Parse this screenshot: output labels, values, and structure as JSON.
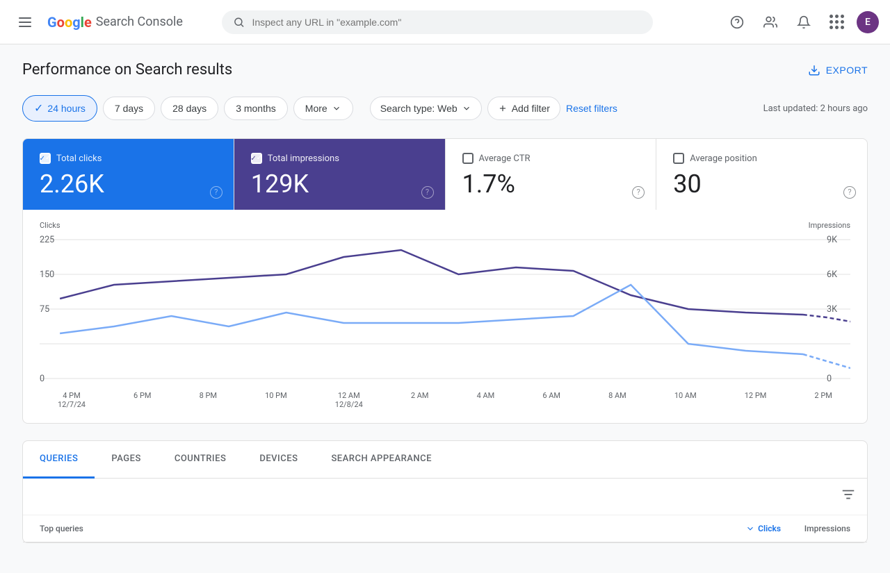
{
  "app": {
    "title": "Google Search Console",
    "logo_text": "Google",
    "logo_product": "Search Console"
  },
  "navbar": {
    "search_placeholder": "Inspect any URL in \"example.com\"",
    "avatar_initial": "E"
  },
  "page": {
    "title": "Performance on Search results",
    "export_label": "EXPORT",
    "last_updated": "Last updated: 2 hours ago"
  },
  "filters": {
    "time_filters": [
      {
        "label": "24 hours",
        "active": true
      },
      {
        "label": "7 days",
        "active": false
      },
      {
        "label": "28 days",
        "active": false
      },
      {
        "label": "3 months",
        "active": false
      },
      {
        "label": "More",
        "active": false,
        "has_arrow": true
      }
    ],
    "search_type_label": "Search type: Web",
    "add_filter_label": "Add filter",
    "reset_filters_label": "Reset filters"
  },
  "metrics": [
    {
      "label": "Total clicks",
      "value": "2.26K",
      "active": true,
      "color": "blue",
      "checked": true
    },
    {
      "label": "Total impressions",
      "value": "129K",
      "active": true,
      "color": "purple",
      "checked": true
    },
    {
      "label": "Average CTR",
      "value": "1.7%",
      "active": false,
      "checked": false
    },
    {
      "label": "Average position",
      "value": "30",
      "active": false,
      "checked": false
    }
  ],
  "chart": {
    "y_axis_left_label": "Clicks",
    "y_axis_right_label": "Impressions",
    "y_left_values": [
      "225",
      "150",
      "75",
      "0"
    ],
    "y_right_values": [
      "9K",
      "6K",
      "3K",
      "0"
    ],
    "x_labels": [
      {
        "time": "4 PM",
        "date": "12/7/24"
      },
      {
        "time": "6 PM",
        "date": ""
      },
      {
        "time": "8 PM",
        "date": ""
      },
      {
        "time": "10 PM",
        "date": ""
      },
      {
        "time": "12 AM",
        "date": "12/8/24"
      },
      {
        "time": "2 AM",
        "date": ""
      },
      {
        "time": "4 AM",
        "date": ""
      },
      {
        "time": "6 AM",
        "date": ""
      },
      {
        "time": "8 AM",
        "date": ""
      },
      {
        "time": "10 AM",
        "date": ""
      },
      {
        "time": "12 PM",
        "date": ""
      },
      {
        "time": "2 PM",
        "date": ""
      }
    ]
  },
  "bottom_tabs": {
    "tabs": [
      "QUERIES",
      "PAGES",
      "COUNTRIES",
      "DEVICES",
      "SEARCH APPEARANCE"
    ],
    "active_tab": 0
  },
  "table": {
    "col_queries": "Top queries",
    "col_clicks": "Clicks",
    "col_impressions": "Impressions"
  }
}
